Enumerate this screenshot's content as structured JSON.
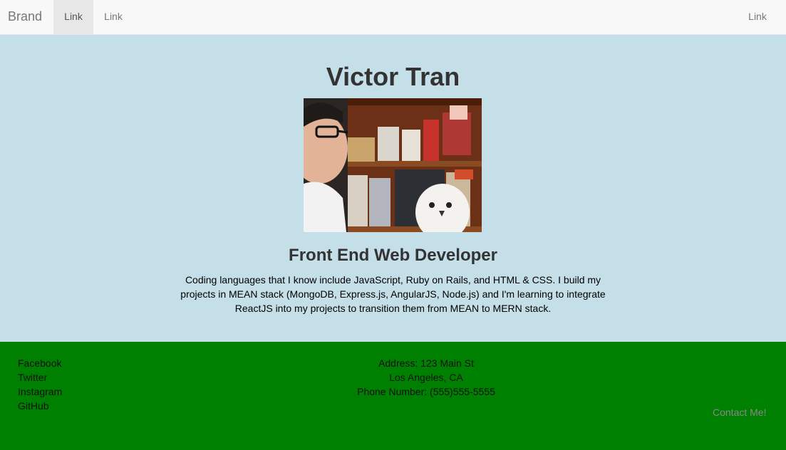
{
  "navbar": {
    "brand": "Brand",
    "links": [
      "Link",
      "Link"
    ],
    "right_link": "Link"
  },
  "hero": {
    "name": "Victor Tran",
    "role": "Front End Web Developer",
    "bio": "Coding languages that I know include JavaScript, Ruby on Rails, and HTML & CSS. I build my projects in MEAN stack (MongoDB, Express.js, AngularJS, Node.js) and I'm learning to integrate ReactJS into my projects to transition them from MEAN to MERN stack."
  },
  "footer": {
    "social": [
      "Facebook",
      "Twitter",
      "Instagram",
      "GitHub"
    ],
    "address_line1": "Address: 123 Main St",
    "address_line2": "Los Angeles, CA",
    "phone": "Phone Number: (555)555-5555",
    "contact_label": "Contact Me!"
  },
  "colors": {
    "hero_bg": "#c4dfe8",
    "footer_bg": "#008000",
    "navbar_bg": "#f8f8f8"
  }
}
